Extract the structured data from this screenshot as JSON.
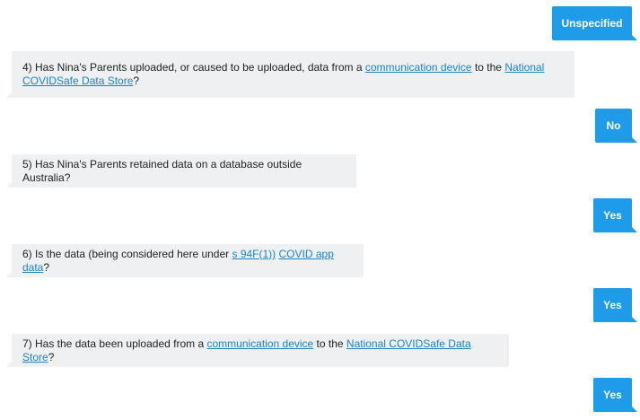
{
  "answers": {
    "a3": "Unspecified",
    "a4": "No",
    "a5": "Yes",
    "a6": "Yes",
    "a7": "Yes"
  },
  "questions": {
    "q4": {
      "prefix": "4) Has Nina's Parents uploaded, or caused to be uploaded, data from a ",
      "link1": "communication device",
      "middle": " to the ",
      "link2": "National COVIDSafe Data Store",
      "suffix": "?"
    },
    "q5": {
      "text": "5) Has Nina's Parents retained data on a database outside Australia?"
    },
    "q6": {
      "prefix": "6) Is the data (being considered here under ",
      "link1": "s 94F(1))",
      "middle": " ",
      "link2": "COVID app data",
      "suffix": "?"
    },
    "q7": {
      "prefix": "7) Has the data been uploaded from a ",
      "link1": "communication device",
      "middle": " to the ",
      "link2": "National COVIDSafe Data Store",
      "suffix": "?"
    }
  },
  "colors": {
    "user_bubble": "#1e9be9",
    "bot_bubble": "#eef0f2",
    "link": "#1a84c6"
  }
}
